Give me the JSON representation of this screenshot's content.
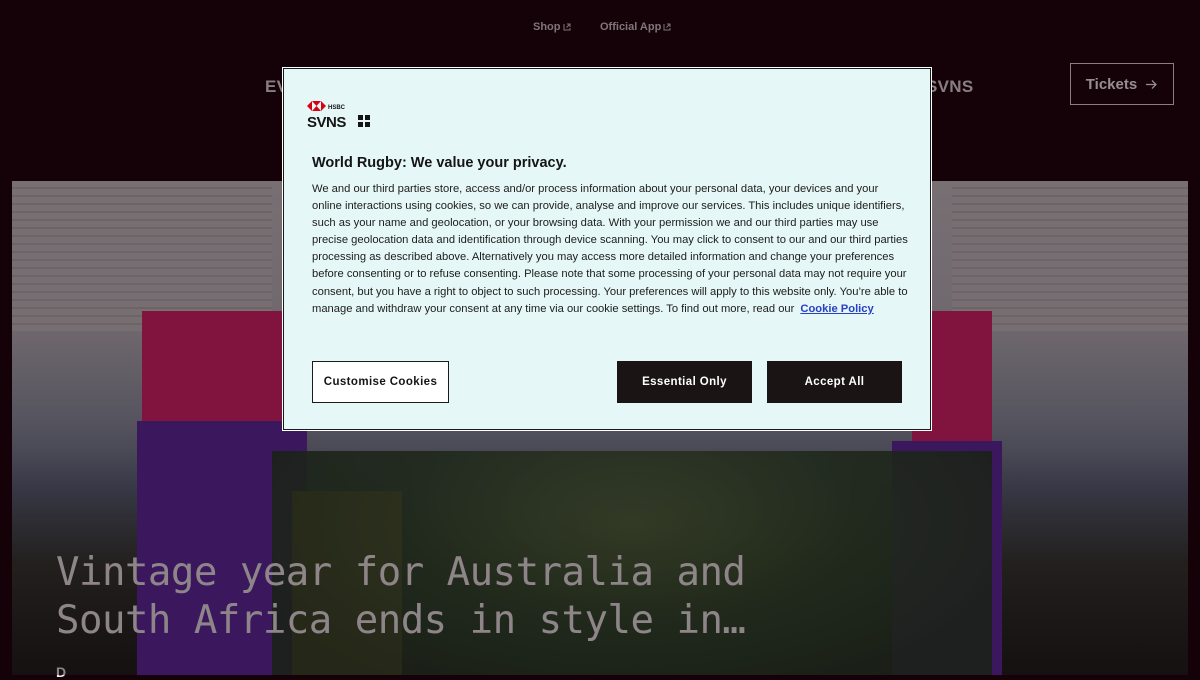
{
  "utility_nav": {
    "shop_label": "Shop",
    "app_label": "Official App"
  },
  "main_nav": {
    "left_fragment": "EV",
    "right_fragment": "SVNS",
    "tickets_label": "Tickets"
  },
  "hero": {
    "headline": "Vintage year for Australia and South Africa ends in style in…",
    "sub_fragment": "D"
  },
  "cookie_modal": {
    "logo_top_text": "HSBC",
    "logo_main_text": "SVNS",
    "title": "World Rugby: We value your privacy.",
    "body": "We and our third parties store, access and/or process information about your personal data, your devices and your online interactions using cookies, so we can provide, analyse and improve our services. This includes unique identifiers, such as your name and geolocation, or your browsing data. With your permission we and our third parties may use precise geolocation data and identification through device scanning. You may click to consent to our and our third parties processing as described above. Alternatively you may access more detailed information and change your preferences before consenting or to refuse consenting. Please note that some processing of your personal data may not require your consent, but you have a right to object to such processing. Your preferences will apply to this website only. You’re able to manage and withdraw your consent at any time via our cookie settings. To find out more, read our",
    "policy_link_label": "Cookie Policy",
    "customise_label": "Customise Cookies",
    "essential_label": "Essential Only",
    "accept_label": "Accept All"
  },
  "colors": {
    "page_bg": "#140208",
    "modal_bg": "#e5f7f6",
    "button_dark": "#1b1414",
    "link_blue": "#2a40c4",
    "hsbc_red": "#db0011"
  },
  "icons": [
    "external-link-icon",
    "arrow-right-icon",
    "hsbc-hexagon-icon"
  ]
}
